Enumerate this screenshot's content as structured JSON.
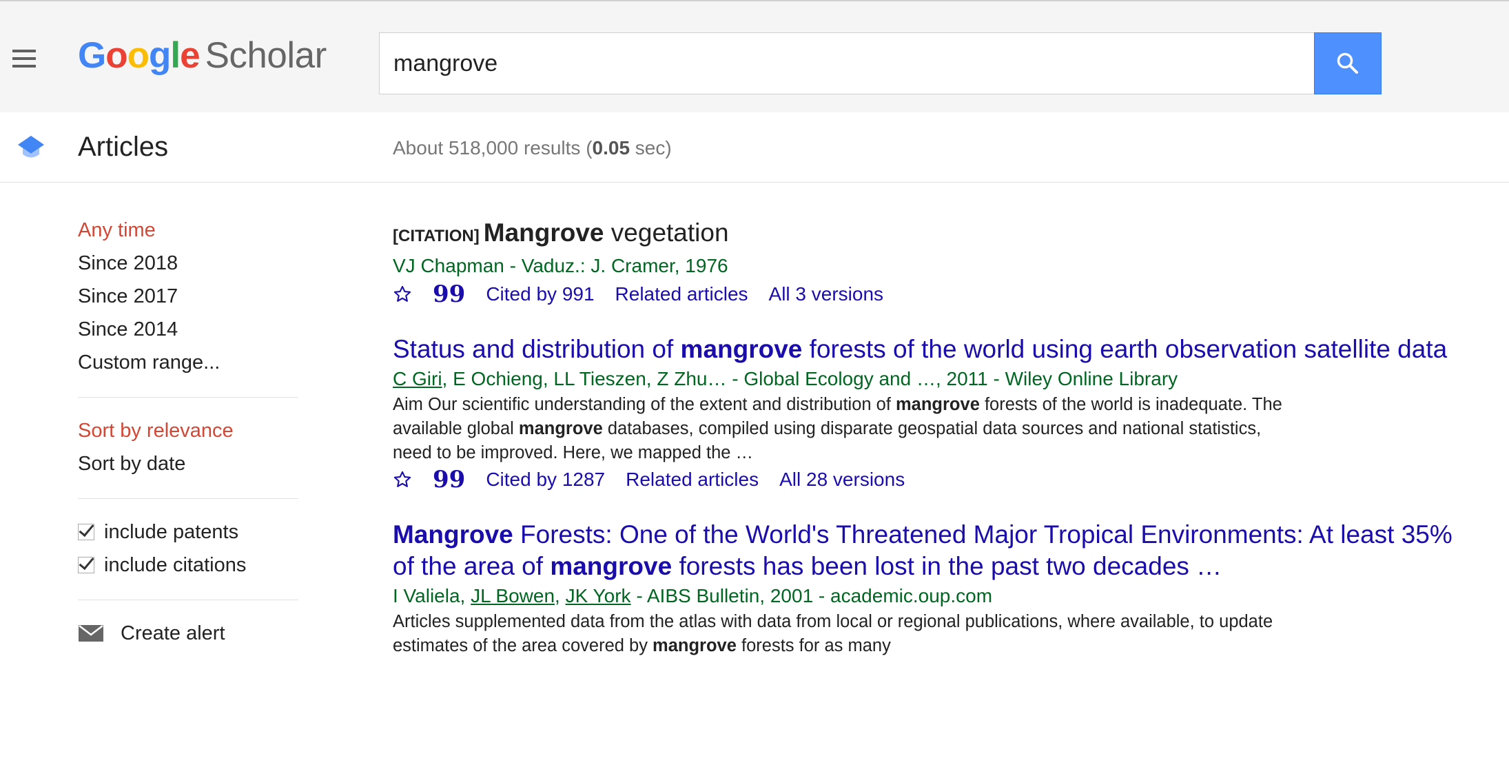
{
  "header": {
    "logo_text": "Google",
    "logo_suffix": "Scholar",
    "brand_colors": [
      "#4285f4",
      "#ea4335",
      "#fbbc05",
      "#4285f4",
      "#34a853",
      "#ea4335"
    ],
    "search_value": "mangrove",
    "search_button_color": "#4d90fe"
  },
  "subbar": {
    "section_label": "Articles",
    "stats_prefix": "About 518,000 results (",
    "stats_time": "0.05",
    "stats_suffix": " sec)"
  },
  "sidebar": {
    "time_filters": [
      "Any time",
      "Since 2018",
      "Since 2017",
      "Since 2014",
      "Custom range..."
    ],
    "sort_options": [
      "Sort by relevance",
      "Sort by date"
    ],
    "checkboxes": [
      "include patents",
      "include citations"
    ],
    "create_alert": "Create alert",
    "active_color": "#d14836"
  },
  "results": [
    {
      "tag": "[CITATION]",
      "title_bold": "Mangrove",
      "title_rest": " vegetation",
      "authors": "VJ Chapman - Vaduz.: J. Cramer, 1976",
      "cited_by": "Cited by 991",
      "related": "Related articles",
      "versions": "All 3 versions"
    },
    {
      "title_a": "Status and distribution of ",
      "title_bold": "mangrove",
      "title_b": " forests of the world using earth observation satellite data",
      "author_link": "C Giri",
      "authors_rest": ", E Ochieng, LL Tieszen, Z Zhu… - Global Ecology and …, 2011 - Wiley Online Library",
      "snippet": [
        "Aim Our scientific understanding of the extent and distribution of ",
        "mangrove",
        " forests of the world is inadequate. The available global ",
        "mangrove",
        " databases, compiled using disparate geospatial data sources and national statistics, need to be improved. Here, we mapped the …"
      ],
      "cited_by": "Cited by 1287",
      "related": "Related articles",
      "versions": "All 28 versions"
    },
    {
      "title_bold1": "Mangrove",
      "title_a": " Forests: One of the World's Threatened Major Tropical Environments: At least 35% of the area of ",
      "title_bold2": "mangrove",
      "title_b": " forests has been lost in the past two decades …",
      "authors_a": "I Valiela, ",
      "author_link1": "JL Bowen",
      "authors_sep": ", ",
      "author_link2": "JK York",
      "authors_rest": " - AIBS Bulletin, 2001 - academic.oup.com",
      "snippet": [
        "Articles supplemented data from the atlas with data from local or regional publications, where available, to update estimates of the area covered by ",
        "mangrove",
        " forests for as many"
      ]
    }
  ]
}
